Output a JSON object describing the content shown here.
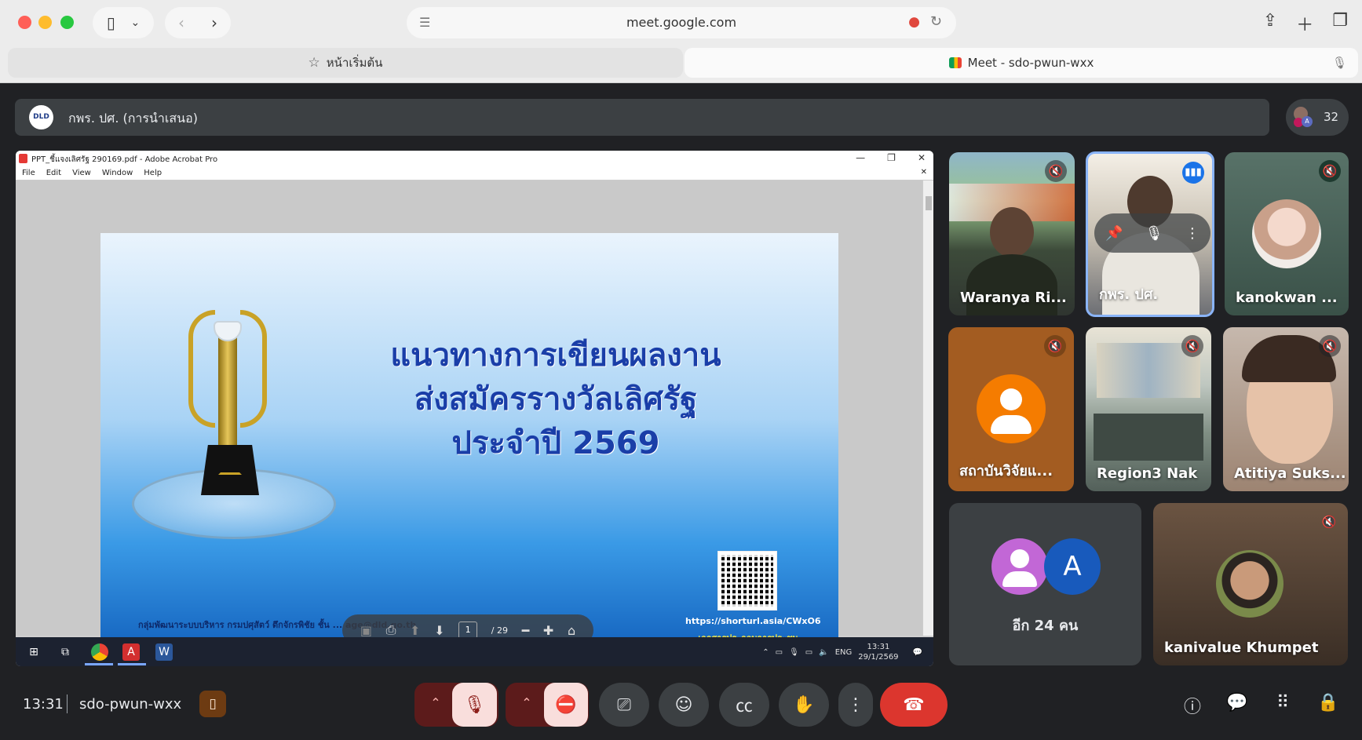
{
  "browser": {
    "url": "meet.google.com",
    "tabs": [
      {
        "label": "หน้าเริ่มต้น",
        "active": false
      },
      {
        "label": "Meet - sdo-pwun-wxx",
        "active": true
      }
    ],
    "icons": [
      "sidebar-icon",
      "chevron-down-icon",
      "back-icon",
      "forward-icon",
      "mic-icon",
      "reload-icon",
      "share-icon",
      "new-tab-icon",
      "tabs-overview-icon"
    ]
  },
  "meet": {
    "presenter_title": "กพร. ปศ. (การนำเสนอ)",
    "presenter_logo": "DLD",
    "participant_count": "32",
    "meeting_time": "13:31",
    "meeting_code": "sdo-pwun-wxx"
  },
  "shared_screen": {
    "window_title": "PPT_ชี้แจงเลิศรัฐ 290169.pdf - Adobe Acrobat Pro",
    "menu": [
      "File",
      "Edit",
      "View",
      "Window",
      "Help"
    ],
    "slide": {
      "title_lines": [
        "แนวทางการเขียนผลงาน",
        "ส่งสมัครรางวัลเลิศรัฐ",
        "ประจำปี 2569"
      ],
      "footer": "กลุ่มพัฒนาระบบบริหาร กรมปศุสัตว์ ตึกจักรพิชัย ชั้น ... age@dld.go.th",
      "qr_link": "https://shorturl.asia/CWxO6",
      "qr_caption": "เอกสารประกอบการประชุม"
    },
    "pdf_toolbar": {
      "current_page": "1",
      "total_pages": "/ 29"
    },
    "taskbar": {
      "lang": "ENG",
      "time": "13:31",
      "date": "29/1/2569"
    }
  },
  "participants": [
    {
      "name": "Waranya Ri...",
      "muted": true
    },
    {
      "name": "กพร. ปศ.",
      "muted": false,
      "speaking": true
    },
    {
      "name": "kanokwan ...",
      "muted": true
    },
    {
      "name": "สถาบันวิจัยแ...",
      "muted": true
    },
    {
      "name": "Region3 Nak",
      "muted": true
    },
    {
      "name": "Atitiya Suks...",
      "muted": true
    },
    {
      "name": "kanivalue Khumpet",
      "muted": true
    }
  ],
  "more_participants": {
    "label": "อีก 24 คน",
    "avatar_letter": "A"
  },
  "colors": {
    "meet_bg": "#202124",
    "tile_bg": "#3c4043",
    "end_call": "#dc362e",
    "mic_off_bg": "#f9dedc",
    "speaking_blue": "#1a73e8",
    "slide_title": "#1a3ea8"
  }
}
